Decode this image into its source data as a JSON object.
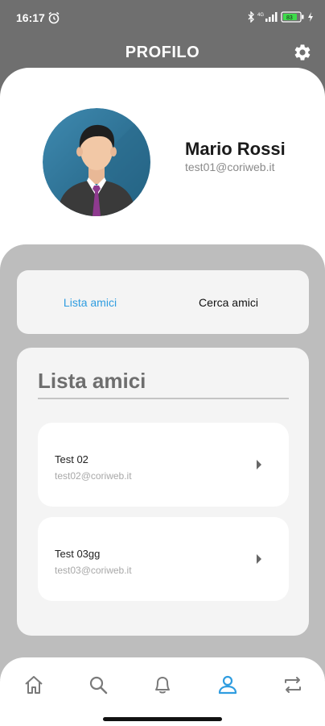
{
  "status_bar": {
    "time": "16:17",
    "battery_level": "83"
  },
  "header": {
    "title": "PROFILO"
  },
  "profile": {
    "name": "Mario Rossi",
    "email": "test01@coriweb.it"
  },
  "tabs": [
    {
      "label": "Lista amici",
      "active": true
    },
    {
      "label": "Cerca amici",
      "active": false
    }
  ],
  "friends_list": {
    "title": "Lista amici",
    "items": [
      {
        "name": "Test 02",
        "email": "test02@coriweb.it"
      },
      {
        "name": "Test 03gg",
        "email": "test03@coriweb.it"
      }
    ]
  },
  "bottom_nav": {
    "items": [
      "home-icon",
      "search-icon",
      "bell-icon",
      "user-icon",
      "swap-icon"
    ],
    "active": "user-icon"
  },
  "colors": {
    "accent": "#2f9de0",
    "header_bg": "#6f6f6f",
    "panel_bg": "#bdbdbd"
  }
}
